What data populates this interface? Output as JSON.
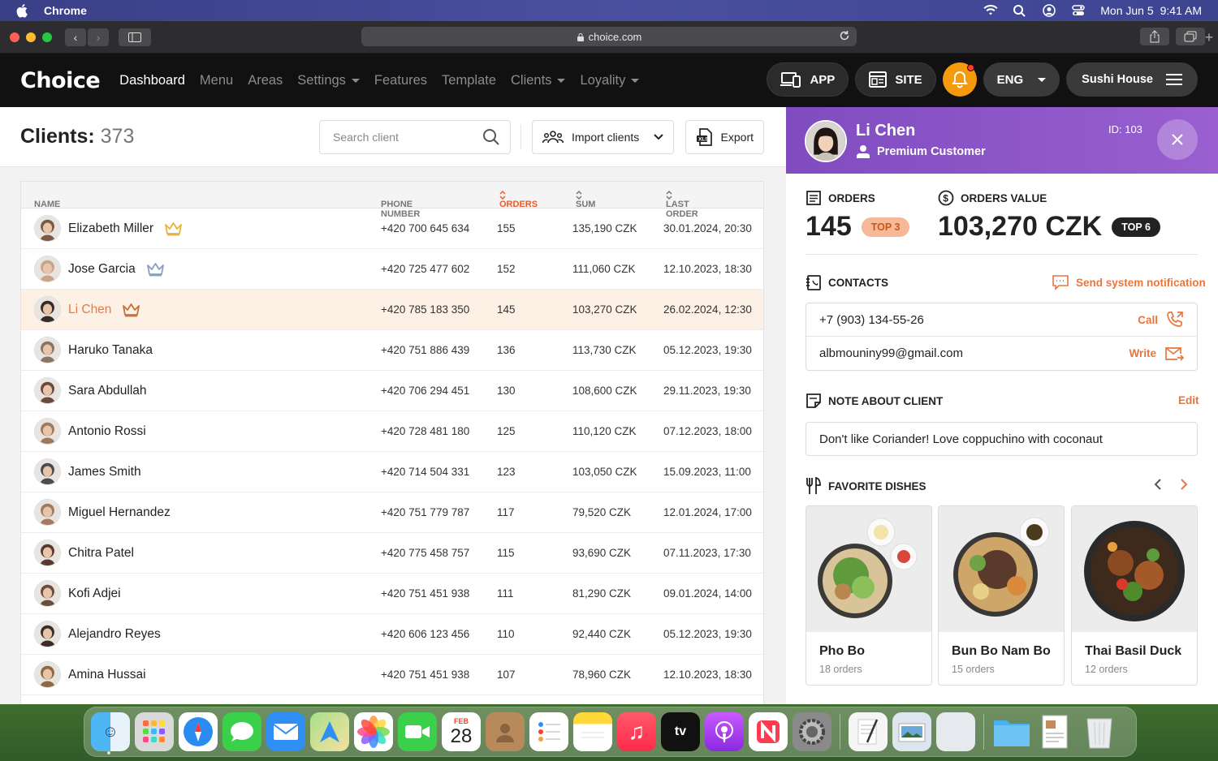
{
  "menubar": {
    "app_name": "Chrome",
    "date": "Mon Jun 5",
    "time": "9:41 AM"
  },
  "browser": {
    "url": "choice.com"
  },
  "header": {
    "logo": "Choice",
    "nav": [
      {
        "label": "Dashboard",
        "active": true,
        "dropdown": false
      },
      {
        "label": "Menu",
        "active": false,
        "dropdown": false
      },
      {
        "label": "Areas",
        "active": false,
        "dropdown": false
      },
      {
        "label": "Settings",
        "active": false,
        "dropdown": true
      },
      {
        "label": "Features",
        "active": false,
        "dropdown": false
      },
      {
        "label": "Template",
        "active": false,
        "dropdown": false
      },
      {
        "label": "Clients",
        "active": false,
        "dropdown": true
      },
      {
        "label": "Loyality",
        "active": false,
        "dropdown": true
      }
    ],
    "app_label": "APP",
    "site_label": "SITE",
    "lang_label": "ENG",
    "venue_label": "Sushi House",
    "accent_color": "#f59a0c"
  },
  "clients": {
    "title": "Clients:",
    "count": "373",
    "search_placeholder": "Search client",
    "import_label": "Import clients",
    "export_label": "Export"
  },
  "table": {
    "columns": {
      "name": "NAME",
      "phone": "PHONE NUMBER",
      "orders": "ORDERS",
      "sum": "SUM",
      "last_order": "LAST ORDER"
    },
    "rows": [
      {
        "name": "Elizabeth Miller",
        "phone": "+420 700 645 634",
        "orders": "155",
        "sum": "135,190 CZK",
        "last": "30.01.2024, 20:30",
        "crown": "gold",
        "avatar_color": "#7a5a44"
      },
      {
        "name": "Jose Garcia",
        "phone": "+420 725 477 602",
        "orders": "152",
        "sum": "111,060 CZK",
        "last": "12.10.2023, 18:30",
        "crown": "silver",
        "avatar_color": "#c7a58a"
      },
      {
        "name": "Li Chen",
        "phone": "+420 785 183 350",
        "orders": "145",
        "sum": "103,270 CZK",
        "last": "26.02.2024, 12:30",
        "crown": "bronze",
        "avatar_color": "#3a2a22",
        "selected": true
      },
      {
        "name": "Haruko Tanaka",
        "phone": "+420 751 886 439",
        "orders": "136",
        "sum": "113,730 CZK",
        "last": "05.12.2023, 19:30",
        "avatar_color": "#8a7565"
      },
      {
        "name": "Sara Abdullah",
        "phone": "+420 706 294 451",
        "orders": "130",
        "sum": "108,600 CZK",
        "last": "29.11.2023, 19:30",
        "avatar_color": "#6a4a3c"
      },
      {
        "name": "Antonio Rossi",
        "phone": "+420 728 481 180",
        "orders": "125",
        "sum": "110,120 CZK",
        "last": "07.12.2023, 18:00",
        "avatar_color": "#9c7a5e"
      },
      {
        "name": "James Smith",
        "phone": "+420 714 504 331",
        "orders": "123",
        "sum": "103,050 CZK",
        "last": "15.09.2023, 11:00",
        "avatar_color": "#4d4a52"
      },
      {
        "name": "Miguel Hernandez",
        "phone": "+420 751 779 787",
        "orders": "117",
        "sum": "79,520 CZK",
        "last": "12.01.2024, 17:00",
        "avatar_color": "#a07a62"
      },
      {
        "name": "Chitra Patel",
        "phone": "+420 775 458 757",
        "orders": "115",
        "sum": "93,690 CZK",
        "last": "07.11.2023, 17:30",
        "avatar_color": "#5a3a2e"
      },
      {
        "name": "Kofi Adjei",
        "phone": "+420 751 451 938",
        "orders": "111",
        "sum": "81,290 CZK",
        "last": "09.01.2024, 14:00",
        "avatar_color": "#6b4d3d"
      },
      {
        "name": "Alejandro Reyes",
        "phone": "+420 606 123 456",
        "orders": "110",
        "sum": "92,440 CZK",
        "last": "05.12.2023, 19:30",
        "avatar_color": "#3d2d28"
      },
      {
        "name": "Amina Hussai",
        "phone": "+420 751 451 938",
        "orders": "107",
        "sum": "78,960 CZK",
        "last": "12.10.2023, 18:30",
        "avatar_color": "#8c6a48"
      }
    ]
  },
  "profile": {
    "name": "Li Chen",
    "status": "Premium Customer",
    "id_label": "ID: 103",
    "header_color": "#8a55c8",
    "orders_label": "ORDERS",
    "orders_value": "145",
    "orders_badge": "TOP 3",
    "value_label": "ORDERS VALUE",
    "value_amount": "103,270 CZK",
    "value_badge": "TOP 6",
    "contacts_label": "CONTACTS",
    "notify_label": "Send system notification",
    "phone": "+7 (903) 134-55-26",
    "call_label": "Call",
    "email": "albmouniny99@gmail.com",
    "write_label": "Write",
    "note_label": "NOTE ABOUT CLIENT",
    "edit_label": "Edit",
    "note": "Don't like Coriander! Love coppuchino with coconaut",
    "dishes_label": "FAVORITE DISHES",
    "dishes": [
      {
        "name": "Pho Bo",
        "orders": "18 orders"
      },
      {
        "name": "Bun Bo Nam Bo",
        "orders": "15 orders"
      },
      {
        "name": "Thai Basil Duck",
        "orders": "12 orders"
      }
    ]
  },
  "dock": {
    "calendar_month": "FEB",
    "calendar_day": "28",
    "tv_label": "tv"
  }
}
